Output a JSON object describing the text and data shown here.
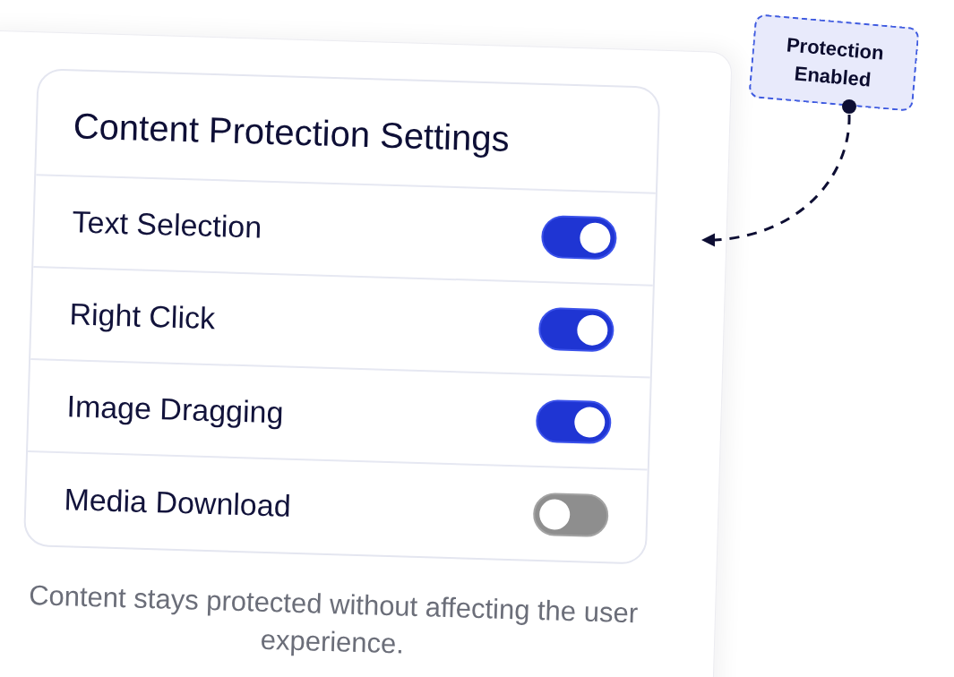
{
  "panel": {
    "title": "Content Protection Settings",
    "settings": [
      {
        "label": "Text Selection",
        "on": true
      },
      {
        "label": "Right Click",
        "on": true
      },
      {
        "label": "Image Dragging",
        "on": true
      },
      {
        "label": "Media Download",
        "on": false
      }
    ],
    "caption": "Content stays protected without affecting the user experience."
  },
  "callout": {
    "text": "Protection Enabled"
  }
}
